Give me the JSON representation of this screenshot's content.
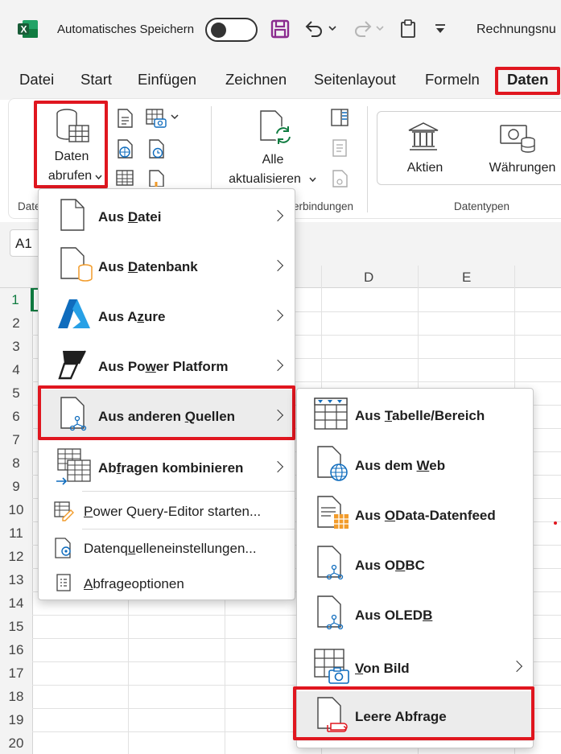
{
  "titlebar": {
    "autosave_label": "Automatisches Speichern",
    "doc_title": "Rechnungsnu"
  },
  "tabs": [
    "Datei",
    "Start",
    "Einfügen",
    "Zeichnen",
    "Seitenlayout",
    "Formeln",
    "Daten"
  ],
  "ribbon": {
    "get_data": {
      "line1": "Daten",
      "line2": "abrufen"
    },
    "refresh_all": {
      "line1": "Alle",
      "line2": "aktualisieren"
    },
    "stocks": "Aktien",
    "currencies": "Währungen",
    "group_get": "Date",
    "group_connections": "erbindungen",
    "group_datatypes": "Datentypen"
  },
  "namebox": "A1",
  "columns": [
    "D",
    "E"
  ],
  "rows": [
    "1",
    "2",
    "3",
    "4",
    "5",
    "6",
    "7",
    "8",
    "9",
    "10",
    "11",
    "12",
    "13",
    "14",
    "15",
    "16",
    "17",
    "18",
    "19",
    "20"
  ],
  "menu": {
    "from_file": {
      "pre": "Aus ",
      "key": "D",
      "post": "atei"
    },
    "from_database": {
      "pre": "Aus ",
      "key": "D",
      "post": "atenbank"
    },
    "from_azure": {
      "pre": "Aus A",
      "key": "z",
      "post": "ure"
    },
    "from_power_platform": {
      "pre": "Aus Po",
      "key": "w",
      "post": "er Platform"
    },
    "from_other_sources": {
      "pre": "Aus anderen ",
      "key": "Q",
      "post": "uellen"
    },
    "combine_queries": {
      "pre": "Ab",
      "key": "f",
      "post": "ragen kombinieren"
    },
    "launch_pq_editor": {
      "pre": "",
      "key": "P",
      "post": "ower Query-Editor starten..."
    },
    "data_source_settings": {
      "pre": "Datenq",
      "key": "u",
      "post": "elleneinstellungen..."
    },
    "query_options": {
      "pre": "",
      "key": "A",
      "post": "bfrageoptionen"
    }
  },
  "submenu": {
    "from_table": {
      "pre": "Aus ",
      "key": "T",
      "post": "abelle/Bereich"
    },
    "from_web": {
      "pre": "Aus dem ",
      "key": "W",
      "post": "eb"
    },
    "from_odata": {
      "pre": "Aus ",
      "key": "O",
      "post": "Data-Datenfeed"
    },
    "from_odbc": {
      "pre": "Aus O",
      "key": "D",
      "post": "BC"
    },
    "from_oledb": {
      "pre": "Aus OLED",
      "key": "B",
      "post": ""
    },
    "from_picture": {
      "pre": "",
      "key": "V",
      "post": "on Bild"
    },
    "blank_query": {
      "pre": "Leere Abfrage",
      "key": "",
      "post": ""
    }
  },
  "colors": {
    "highlight": "#e0161f",
    "excel_green": "#107c41",
    "icon_blue": "#0f6cbd",
    "db_orange": "#f29c2b"
  }
}
